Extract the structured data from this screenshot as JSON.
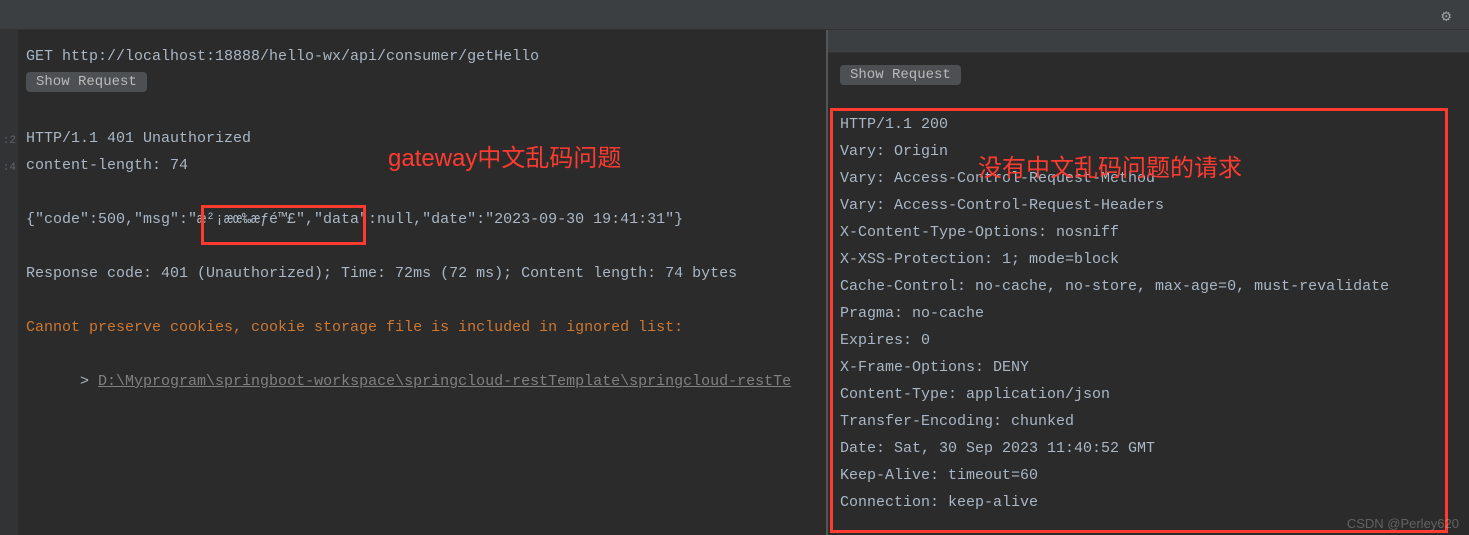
{
  "top": {
    "gear": "⚙"
  },
  "gutter": {
    "l1": ":2",
    "l2": ":4"
  },
  "left": {
    "request_line": "GET http://localhost:18888/hello-wx/api/consumer/getHello",
    "show_request": "Show Request",
    "status_line": "HTTP/1.1 401 Unauthorized",
    "content_length": "content-length: 74",
    "body": "{\"code\":500,\"msg\":\"æ²¡æœ‰æƒé™£\",\"data\":null,\"date\":\"2023-09-30 19:41:31\"}",
    "meta": "Response code: 401 (Unauthorized); Time: 72ms (72 ms); Content length: 74 bytes",
    "warn": "Cannot preserve cookies, cookie storage file is included in ignored list:",
    "path_prefix": "> ",
    "path": "D:\\Myprogram\\springboot-workspace\\springcloud-restTemplate\\springcloud-restTe",
    "annotation": "gateway中文乱码问题"
  },
  "right": {
    "show_request": "Show Request",
    "lines": [
      "HTTP/1.1 200",
      "Vary: Origin",
      "Vary: Access-Control-Request-Method",
      "Vary: Access-Control-Request-Headers",
      "X-Content-Type-Options: nosniff",
      "X-XSS-Protection: 1; mode=block",
      "Cache-Control: no-cache, no-store, max-age=0, must-revalidate",
      "Pragma: no-cache",
      "Expires: 0",
      "X-Frame-Options: DENY",
      "Content-Type: application/json",
      "Transfer-Encoding: chunked",
      "Date: Sat, 30 Sep 2023 11:40:52 GMT",
      "Keep-Alive: timeout=60",
      "Connection: keep-alive"
    ],
    "annotation": "没有中文乱码问题的请求"
  },
  "watermark": "CSDN @Perley620"
}
